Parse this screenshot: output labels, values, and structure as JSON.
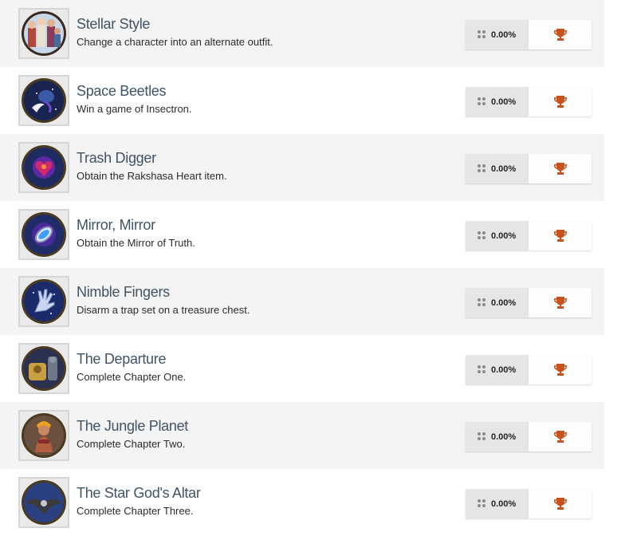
{
  "colors": {
    "title": "#415364",
    "trophy": "#c5541e",
    "row_alt": "#f4f4f4"
  },
  "achievements": [
    {
      "title": "Stellar Style",
      "description": "Change a character into an alternate outfit.",
      "percent": "0.00%",
      "icon": "party-portrait-icon"
    },
    {
      "title": "Space Beetles",
      "description": "Win a game of Insectron.",
      "percent": "0.00%",
      "icon": "beetle-icon"
    },
    {
      "title": "Trash Digger",
      "description": "Obtain the Rakshasa Heart item.",
      "percent": "0.00%",
      "icon": "heart-gem-icon"
    },
    {
      "title": "Mirror, Mirror",
      "description": "Obtain the Mirror of Truth.",
      "percent": "0.00%",
      "icon": "mirror-icon"
    },
    {
      "title": "Nimble Fingers",
      "description": "Disarm a trap set on a treasure chest.",
      "percent": "0.00%",
      "icon": "hand-icon"
    },
    {
      "title": "The Departure",
      "description": "Complete Chapter One.",
      "percent": "0.00%",
      "icon": "robot-crew-icon"
    },
    {
      "title": "The Jungle Planet",
      "description": "Complete Chapter Two.",
      "percent": "0.00%",
      "icon": "warrior-woman-icon"
    },
    {
      "title": "The Star God's Altar",
      "description": "Complete Chapter Three.",
      "percent": "0.00%",
      "icon": "winged-altar-icon"
    }
  ]
}
